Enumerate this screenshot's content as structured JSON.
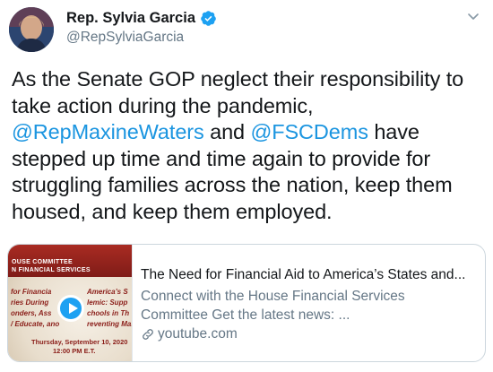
{
  "author": {
    "name": "Rep. Sylvia Garcia",
    "handle": "@RepSylviaGarcia",
    "verified": true
  },
  "tweet": {
    "text_1": "As the Senate GOP neglect their responsibility to take action during the pandemic, ",
    "mention_1": "@RepMaxineWaters",
    "text_2": " and ",
    "mention_2": "@FSCDems",
    "text_3": " have stepped up time and time again to provide for struggling families across the nation, keep them housed, and keep them employed."
  },
  "card": {
    "title": "The Need for Financial Aid to America’s States and...",
    "description": "Connect with the House Financial Services Committee Get the latest news: ...",
    "domain": "youtube.com",
    "thumbnail": {
      "header_line_1": "OUSE COMMITTEE",
      "header_line_2": "N FINANCIAL SERVICES",
      "left_lines": [
        "for Financia",
        "ries During",
        "onders, Ass",
        "/ Educate, ano"
      ],
      "right_lines": [
        "America’s S",
        "lemic: Supp",
        "chools in Th",
        "reventing Mass"
      ],
      "date": "Thursday, September 10, 2020",
      "time": "12:00 PM E.T."
    }
  },
  "colors": {
    "link": "#1b95e0",
    "secondary_text": "#657786",
    "verified": "#1da1f2",
    "thumb_red": "#8a1d18"
  }
}
